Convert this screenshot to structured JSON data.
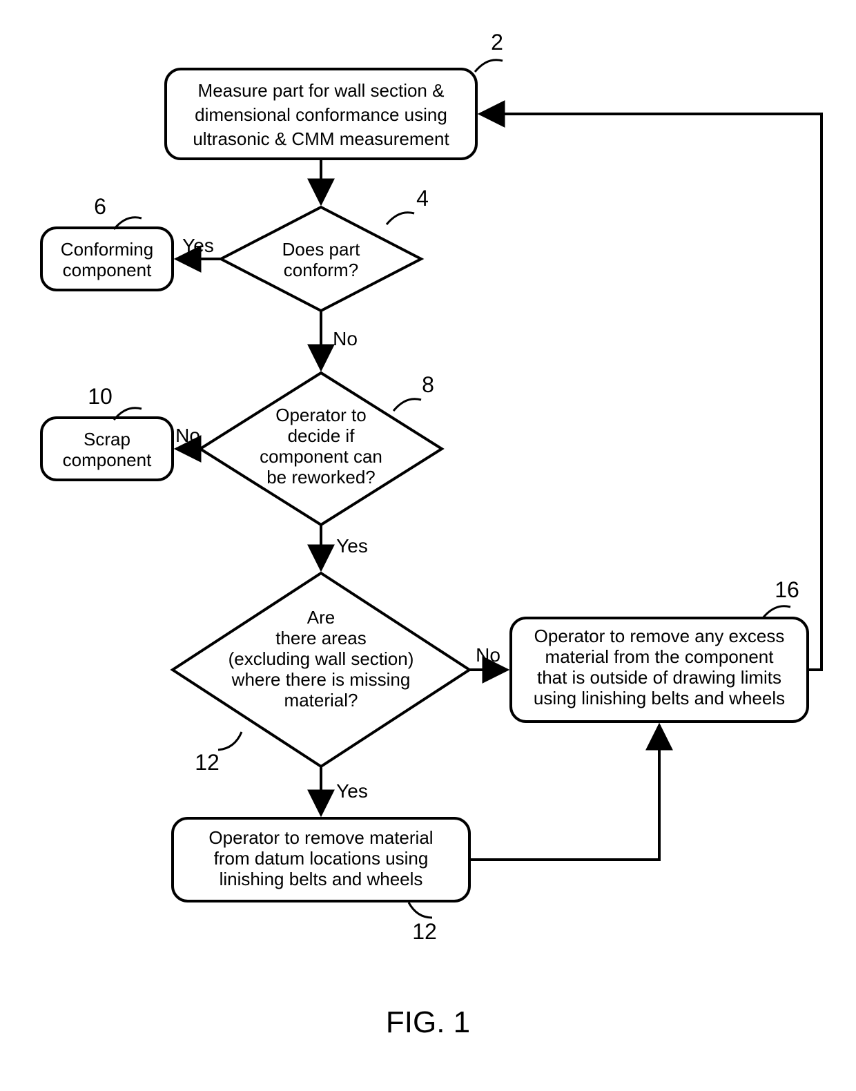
{
  "figure_label": "FIG. 1",
  "edges": {
    "yes": "Yes",
    "no": "No"
  },
  "refs": {
    "measure": "2",
    "conform": "4",
    "conforming": "6",
    "rework": "8",
    "scrap": "10",
    "missing_decision": "12",
    "remove_datum": "12",
    "remove_excess": "16"
  },
  "nodes": {
    "measure": {
      "l1": "Measure part for wall section &",
      "l2": "dimensional conformance using",
      "l3": "ultrasonic & CMM measurement"
    },
    "conforming": {
      "l1": "Conforming",
      "l2": "component"
    },
    "conform": {
      "l1": "Does part",
      "l2": "conform?"
    },
    "scrap": {
      "l1": "Scrap",
      "l2": "component"
    },
    "rework": {
      "l1": "Operator to",
      "l2": "decide if",
      "l3": "component can",
      "l4": "be reworked?"
    },
    "missing": {
      "l1": "Are",
      "l2": "there areas",
      "l3": "(excluding wall section)",
      "l4": "where there is missing",
      "l5": "material?"
    },
    "remove_datum": {
      "l1": "Operator to remove material",
      "l2": "from datum locations using",
      "l3": "linishing belts and wheels"
    },
    "remove_excess": {
      "l1": "Operator to remove any excess",
      "l2": "material from the component",
      "l3": "that is outside of drawing limits",
      "l4": "using linishing belts and wheels"
    }
  }
}
